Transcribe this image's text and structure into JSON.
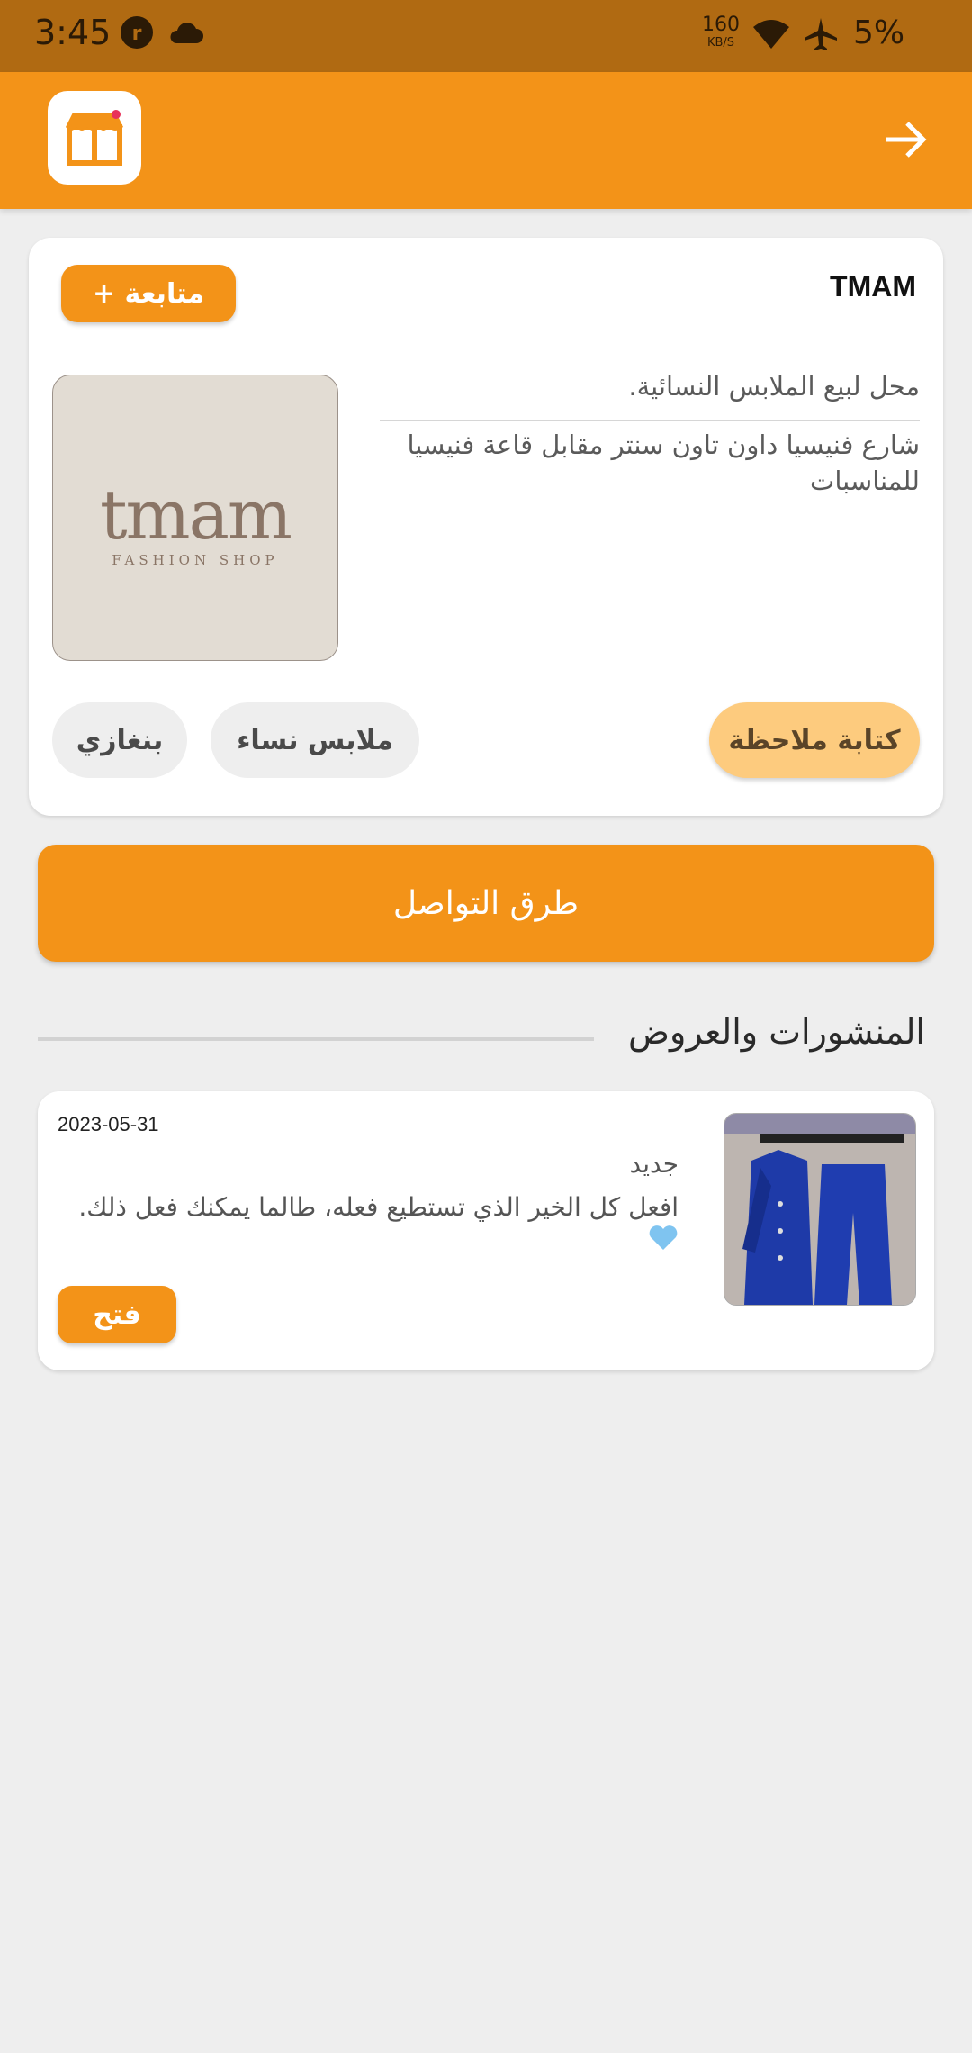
{
  "status_bar": {
    "time": "3:45",
    "net_speed": "160",
    "net_unit": "KB/S",
    "battery": "5%"
  },
  "shop": {
    "name": "TMAM",
    "follow_label": "+ متابعة",
    "logo_wordmark": "tmam",
    "logo_subtitle": "FASHION SHOP",
    "description": "محل لبيع الملابس النسائية.",
    "address": "شارع فنيسيا داون تاون سنتر مقابل قاعة فنيسيا للمناسبات",
    "note_label": "كتابة ملاحظة",
    "category_chip": "ملابس نساء",
    "city_chip": "بنغازي"
  },
  "contact_label": "طرق التواصل",
  "posts_section": {
    "title": "المنشورات والعروض",
    "posts": [
      {
        "date": "2023-05-31",
        "tag": "جديد",
        "text": "افعل كل الخير الذي تستطيع فعله، طالما يمكنك فعل ذلك.",
        "open_label": "فتح"
      }
    ]
  },
  "colors": {
    "accent": "#f39318",
    "status_bar": "#b06a12",
    "note_button": "#fdcb7e",
    "background": "#eeeeee"
  }
}
